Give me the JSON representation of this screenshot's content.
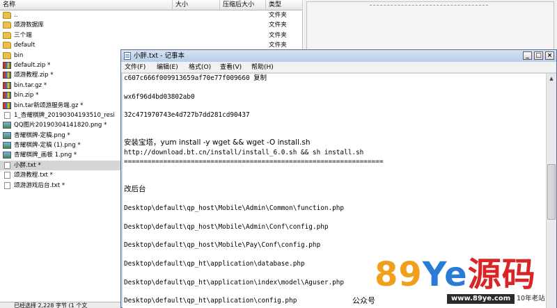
{
  "archive": {
    "columns": [
      "名称",
      "大小",
      "压缩后大小",
      "类型"
    ],
    "files": [
      {
        "name": "..",
        "type": "文件夹",
        "icon": "folder"
      },
      {
        "name": "颂游数据库",
        "type": "文件夹",
        "icon": "folder"
      },
      {
        "name": "三个端",
        "type": "文件夹",
        "icon": "folder"
      },
      {
        "name": "default",
        "type": "文件夹",
        "icon": "folder"
      },
      {
        "name": "bin",
        "type": "文件夹",
        "icon": "folder"
      },
      {
        "name": "default.zip *",
        "type": "",
        "icon": "zip"
      },
      {
        "name": "颂游教程.zip *",
        "type": "",
        "icon": "zip"
      },
      {
        "name": "bin.tar.gz *",
        "type": "",
        "icon": "zip"
      },
      {
        "name": "bin.zip *",
        "type": "",
        "icon": "zip"
      },
      {
        "name": "bin.tar新颂游服务端.gz *",
        "type": "",
        "icon": "zip"
      },
      {
        "name": "1_杏耀棋牌_20190304193510_resi",
        "type": "",
        "icon": "txt"
      },
      {
        "name": "QQ图片20190304141820.png *",
        "type": "",
        "icon": "img"
      },
      {
        "name": "杏耀棋牌-定稿.png *",
        "type": "",
        "icon": "img"
      },
      {
        "name": "杏耀棋牌-定稿 (1).png *",
        "type": "",
        "icon": "img"
      },
      {
        "name": "杏耀棋牌_画板 1.png *",
        "type": "",
        "icon": "img"
      },
      {
        "name": "小胖.txt *",
        "type": "",
        "icon": "txt",
        "selected": true
      },
      {
        "name": "颂游教程.txt *",
        "type": "",
        "icon": "txt"
      },
      {
        "name": "颂游游戏后台.txt *",
        "type": "",
        "icon": "txt"
      }
    ],
    "status": "已经选择 2,228 字节 (1 个文"
  },
  "notepad": {
    "title": "小胖.txt - 记事本",
    "menu": [
      "文件(F)",
      "编辑(E)",
      "格式(O)",
      "查看(V)",
      "帮助(H)"
    ],
    "lines": [
      "c607c666f009913659af70e77f009660 复制",
      "",
      "wx6f96d4bd03802ab0",
      "",
      "32c471970743e4d727b7dd281cd90437",
      "",
      "",
      "安装宝塔，yum install -y wget && wget -O install.sh",
      "http://download.bt.cn/install/install_6.0.sh && sh install.sh",
      "==================================================================",
      "",
      "",
      "改后台",
      "",
      "Desktop\\default\\qp_host\\Mobile\\Admin\\Common\\function.php",
      "",
      "Desktop\\default\\qp_host\\Mobile\\Admin\\Conf\\config.php",
      "",
      "Desktop\\default\\qp_host\\Mobile\\Pay\\Conf\\config.php",
      "",
      "Desktop\\default\\qp_ht\\application\\database.php",
      "",
      "Desktop\\default\\qp_ht\\application\\index\\model\\Aguser.php",
      "",
      "Desktop\\default\\qp_ht\\application\\config.php"
    ]
  },
  "watermark": {
    "brand_a": "89",
    "brand_b": "Ye",
    "brand_c": "源码",
    "public_account": "公众号",
    "url": "www.89ye.com",
    "tagline": "10年老站"
  },
  "colors": {
    "titlebar": "#c9d7ea",
    "brand_orange": "#f0a01c",
    "brand_blue": "#2a7bd8",
    "brand_red": "#d92525"
  }
}
